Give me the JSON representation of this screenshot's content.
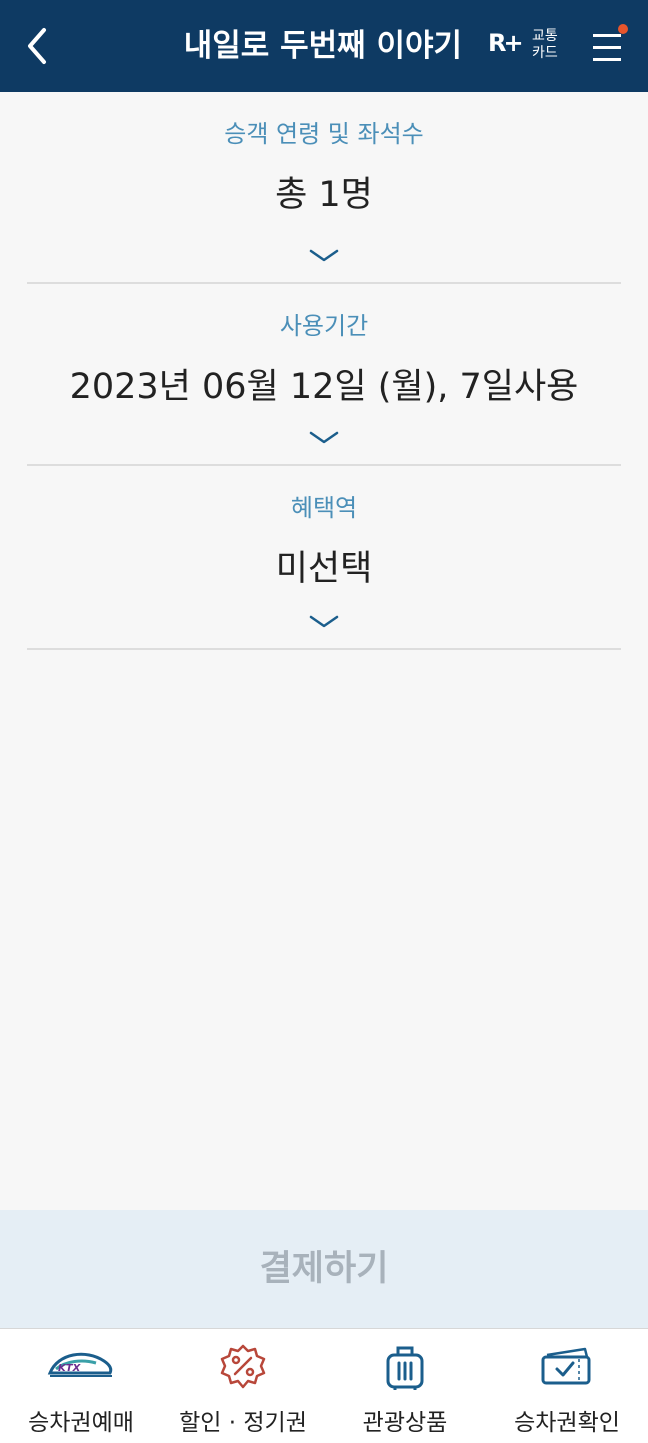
{
  "header": {
    "title": "내일로 두번째 이야기",
    "card_logo": "R+",
    "card_text_top": "교통",
    "card_text_bottom": "카드",
    "back_icon": "chevron-left-icon",
    "menu_icon": "hamburger-menu-icon",
    "bg_color": "#0e3a63",
    "notification_color": "#e7552c"
  },
  "sections": [
    {
      "label": "승객 연령 및 좌석수",
      "value": "총 1명"
    },
    {
      "label": "사용기간",
      "value": "2023년 06월 12일 (월), 7일사용"
    },
    {
      "label": "혜택역",
      "value": "미선택"
    }
  ],
  "pay_button": {
    "label": "결제하기"
  },
  "tabbar": {
    "items": [
      {
        "label": "승차권예매",
        "icon": "ktx-train-icon"
      },
      {
        "label": "할인 · 정기권",
        "icon": "discount-badge-icon"
      },
      {
        "label": "관광상품",
        "icon": "suitcase-icon"
      },
      {
        "label": "승차권확인",
        "icon": "ticket-check-icon"
      }
    ]
  },
  "colors": {
    "label_blue": "#4b8fb8",
    "icon_blue": "#1b5e8c",
    "icon_red": "#b8473a"
  }
}
